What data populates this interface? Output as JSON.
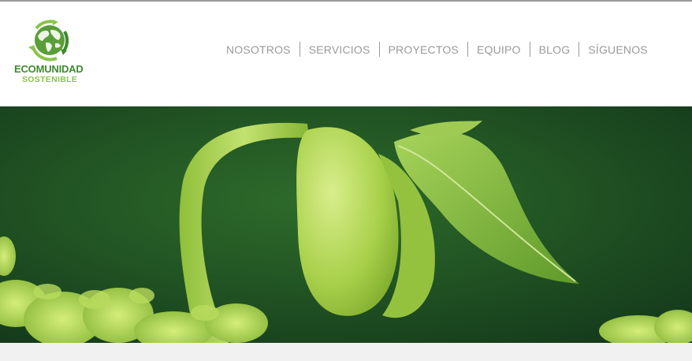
{
  "logo": {
    "line1": "ECOMUNIDAD",
    "line2": "SOSTENIBLE",
    "icon": "globe-recycle-icon"
  },
  "nav": {
    "items": [
      {
        "label": "NOSOTROS"
      },
      {
        "label": "SERVICIOS"
      },
      {
        "label": "PROYECTOS"
      },
      {
        "label": "EQUIPO"
      },
      {
        "label": "BLOG"
      },
      {
        "label": "SÍGUENOS"
      }
    ]
  },
  "colors": {
    "brand_dark": "#3d8a2c",
    "brand_light": "#8bc34a",
    "nav_text": "#9a9a9a"
  }
}
